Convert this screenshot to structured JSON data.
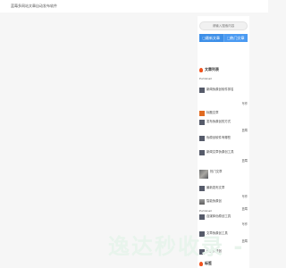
{
  "header": {
    "site_title": "蓝莓多网站文章自动发布软件"
  },
  "sidebar": {
    "search": {
      "placeholder": "请输入搜索内容"
    },
    "buttons": [
      {
        "label": "❑最新文章"
      },
      {
        "label": "❑热门文章"
      }
    ],
    "section_title": "文章列表",
    "articles": [
      {
        "thumb": "Pumbnail",
        "title": "",
        "tag": ""
      },
      {
        "thumb": "",
        "title": "新闻伪原创软件排名",
        "tag": "写作"
      },
      {
        "thumb": "orange",
        "title": "标题文章",
        "tag": ""
      },
      {
        "thumb": "",
        "title": "发布伪原创的方式",
        "tag": "蓝莓"
      },
      {
        "thumb": "",
        "title": "伪原创软件有哪些",
        "tag": ""
      },
      {
        "thumb": "",
        "title": "新闻文章伪原创工具",
        "tag": "蓝莓"
      },
      {
        "thumb": "photo",
        "title": "热门文章",
        "tag": ""
      },
      {
        "thumb": "",
        "title": "最新发布文章",
        "tag": "写作"
      },
      {
        "thumb": "img",
        "title": "智能伪原创",
        "tag": "蓝莓"
      },
      {
        "thumb": "Pumbnail",
        "title": "",
        "tag": ""
      },
      {
        "thumb": "",
        "title": "自媒体伪原创工具",
        "tag": "写作"
      },
      {
        "thumb": "",
        "title": "文章伪原创工具",
        "tag": "蓝莓"
      },
      {
        "thumb": "",
        "title": "免费伪原创",
        "tag": ""
      }
    ]
  },
  "footer": {
    "section_title": "标签"
  },
  "watermark": {
    "text": "逸达秒收录 -"
  }
}
